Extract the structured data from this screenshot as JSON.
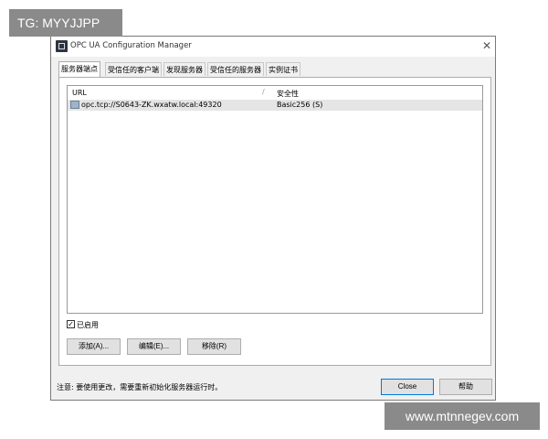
{
  "watermarks": {
    "top_left": "TG: MYYJJPP",
    "bottom_right": "www.mtnnegev.com"
  },
  "window": {
    "title": "OPC UA Configuration Manager",
    "close_glyph": "✕",
    "app_icon": "opc-app-icon"
  },
  "tabs": [
    {
      "label": "服务器端点",
      "active": true
    },
    {
      "label": "受信任的客户端",
      "active": false
    },
    {
      "label": "发现服务器",
      "active": false
    },
    {
      "label": "受信任的服务器",
      "active": false
    },
    {
      "label": "实例证书",
      "active": false
    }
  ],
  "endpoints": {
    "columns": {
      "url": "URL",
      "separator": "/",
      "security": "安全性"
    },
    "rows": [
      {
        "url": "opc.tcp://S0643-ZK.wxatw.local:49320",
        "security": "Basic256 (S)",
        "selected": true,
        "icon": "endpoint-icon"
      }
    ]
  },
  "enabled": {
    "label": "已启用",
    "checked": true,
    "check_glyph": "✓"
  },
  "buttons": {
    "add": "添加(A)...",
    "edit": "编辑(E)...",
    "remove": "移除(R)",
    "close": "Close",
    "help": "帮助"
  },
  "status": "注意: 要使用更改，需要重新初始化服务器运行时。",
  "colors": {
    "selection": "#e5e5e5",
    "default_button_border": "#0078d7",
    "window_bg": "#f0f0f0"
  }
}
